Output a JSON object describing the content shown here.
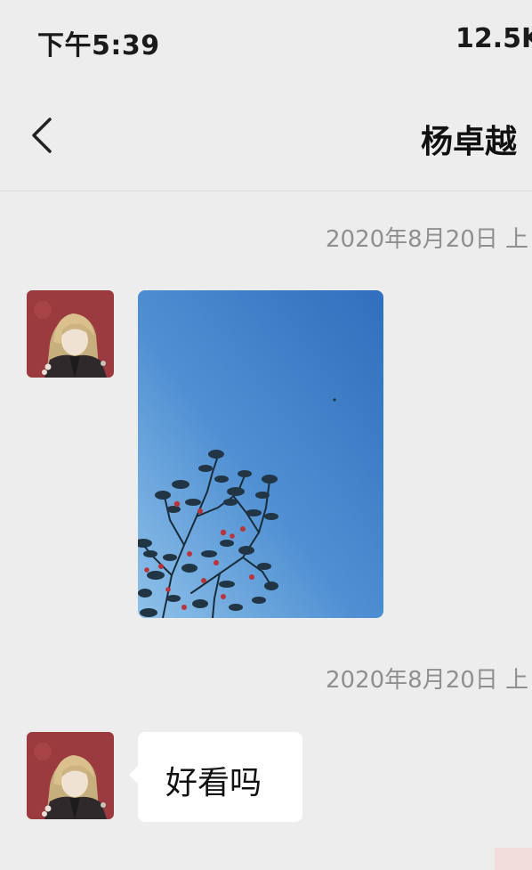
{
  "status_bar": {
    "time": "下午5:39",
    "network_speed": "12.5K"
  },
  "header": {
    "back_icon": "chevron-left-icon",
    "title": "杨卓越"
  },
  "messages": [
    {
      "timestamp": "2020年8月20日 上",
      "type": "image",
      "image_description_icon": "photo-sky-tree"
    },
    {
      "timestamp": "2020年8月20日 上",
      "type": "text",
      "text": "好看吗"
    }
  ],
  "colors": {
    "background": "#ededed",
    "bubble": "#ffffff",
    "timestamp": "#8f8f8f"
  }
}
